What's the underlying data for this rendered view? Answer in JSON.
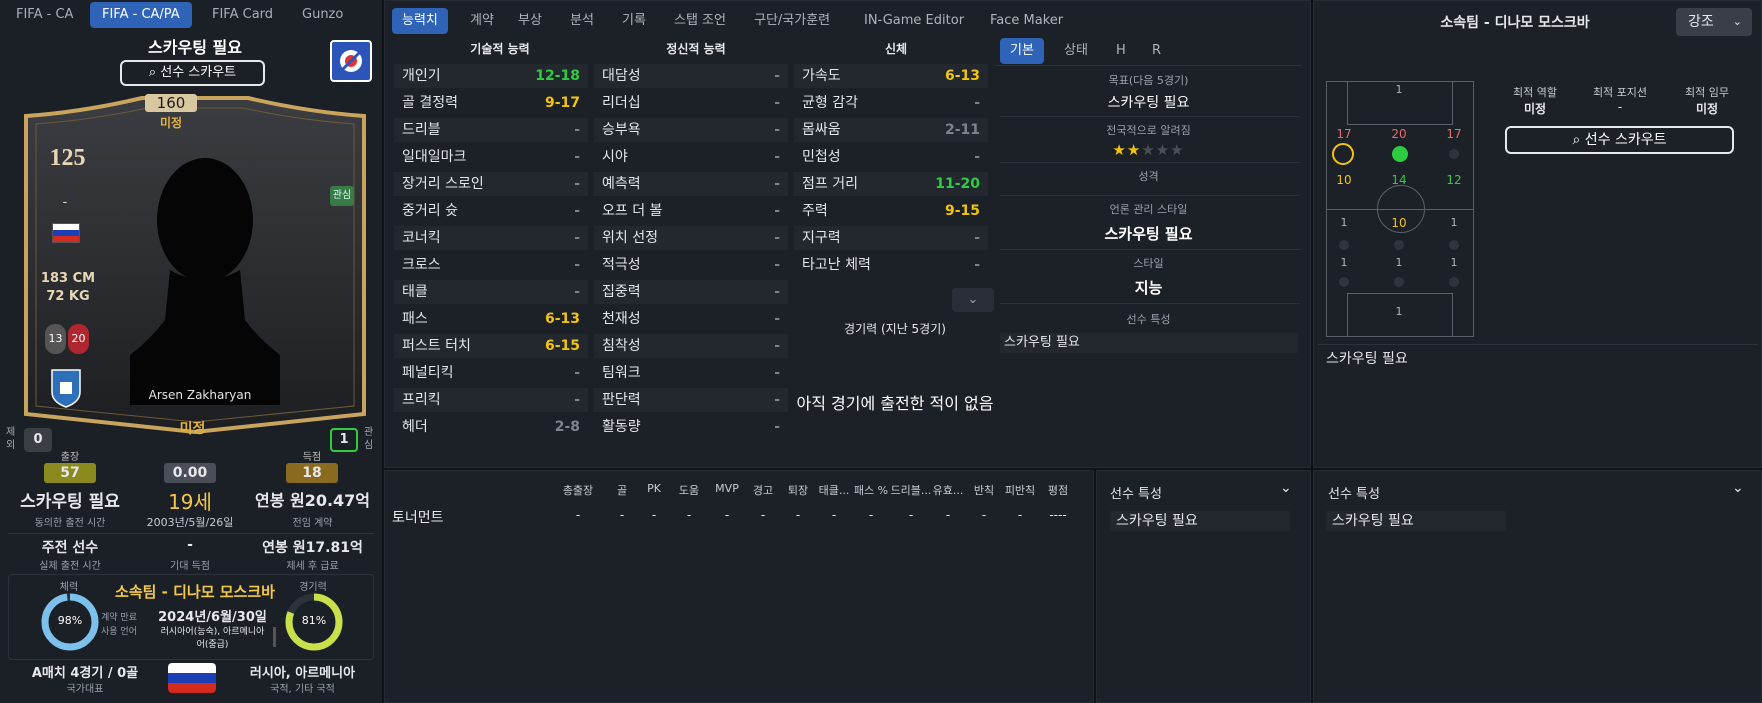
{
  "colors": {
    "accent": "#2e63b8",
    "green": "#2ecc40",
    "yellow": "#f1c40f",
    "red": "#e74c3c",
    "gold": "#c9a45c"
  },
  "top_tabs": [
    "FIFA - CA",
    "FIFA - CA/PA",
    "FIFA Card",
    "Gunzo"
  ],
  "card": {
    "title": "스카우팅 필요",
    "scout_button": "선수 스카우트",
    "pa": "160",
    "pa_label": "미정",
    "ca": "125",
    "dash": "-",
    "height": "183 CM",
    "weight": "72 KG",
    "foot_left": "13",
    "foot_right": "20",
    "tag": "관심",
    "name": "Arsen Zakharyan",
    "status": "미정",
    "flag_icon": "russia-flag-icon",
    "club_icon": "club-crest-icon"
  },
  "stats": {
    "excluded_label": "제외",
    "excluded_value": "0",
    "interest_label": "관심",
    "interest_value": "1",
    "apps_label": "출장",
    "apps_value": "57",
    "rating_value": "0.00",
    "goals_label": "득점",
    "goals_value": "18",
    "playtime": "스카우팅 필요",
    "playtime_label": "동의한 출전 시간",
    "age": "19세",
    "birth": "2003년/5월/26일",
    "salary": "연봉 원20.47억",
    "salary_label": "전임 계약",
    "role": "주전 선수",
    "role_label": "실제 출전 시간",
    "expected": "-",
    "expected_label": "기대 득점",
    "net_salary": "연봉 원17.81억",
    "net_salary_label": "제세 후 급료",
    "fitness_label": "체력",
    "fitness_value": "98%",
    "fitness_pct": 98,
    "club": "소속팀 - 디나모 모스크바",
    "contract_label": "계약 만료",
    "contract": "2024년/6월/30일",
    "language_label": "사용 언어",
    "language": "러시아어(능숙), 아르메니아어(중급)",
    "form_label": "경기력",
    "form_value": "81%",
    "form_pct": 81,
    "intl": "A매치 4경기 / 0골",
    "intl_label": "국가대표",
    "nation": "러시아, 아르메니아",
    "nation_label": "국적, 기타 국적"
  },
  "attr_tabs": [
    "능력치",
    "계약",
    "부상",
    "분석",
    "기록",
    "스탭 조언",
    "구단/국가훈련",
    "IN-Game Editor",
    "Face Maker"
  ],
  "technical": {
    "header": "기술적 능력",
    "rows": [
      [
        "개인기",
        "12-18",
        "g"
      ],
      [
        "골 결정력",
        "9-17",
        "y"
      ],
      [
        "드리블",
        "-",
        "n"
      ],
      [
        "일대일마크",
        "-",
        "n"
      ],
      [
        "장거리 스로인",
        "-",
        "n"
      ],
      [
        "중거리 슛",
        "-",
        "n"
      ],
      [
        "코너킥",
        "-",
        "n"
      ],
      [
        "크로스",
        "-",
        "n"
      ],
      [
        "태클",
        "-",
        "n"
      ],
      [
        "패스",
        "6-13",
        "y"
      ],
      [
        "퍼스트 터치",
        "6-15",
        "y"
      ],
      [
        "페널티킥",
        "-",
        "n"
      ],
      [
        "프리킥",
        "-",
        "n"
      ],
      [
        "헤더",
        "2-8",
        "n"
      ]
    ]
  },
  "mental": {
    "header": "정신적 능력",
    "rows": [
      [
        "대담성",
        "-",
        "n"
      ],
      [
        "리더십",
        "-",
        "n"
      ],
      [
        "승부욕",
        "-",
        "n"
      ],
      [
        "시야",
        "-",
        "n"
      ],
      [
        "예측력",
        "-",
        "n"
      ],
      [
        "오프 더 볼",
        "-",
        "n"
      ],
      [
        "위치 선정",
        "-",
        "n"
      ],
      [
        "적극성",
        "-",
        "n"
      ],
      [
        "집중력",
        "-",
        "n"
      ],
      [
        "천재성",
        "-",
        "n"
      ],
      [
        "침착성",
        "-",
        "n"
      ],
      [
        "팀워크",
        "-",
        "n"
      ],
      [
        "판단력",
        "-",
        "n"
      ],
      [
        "활동량",
        "-",
        "n"
      ]
    ]
  },
  "physical": {
    "header": "신체",
    "rows": [
      [
        "가속도",
        "6-13",
        "y"
      ],
      [
        "균형 감각",
        "-",
        "n"
      ],
      [
        "몸싸움",
        "2-11",
        "n"
      ],
      [
        "민첩성",
        "-",
        "n"
      ],
      [
        "점프 거리",
        "11-20",
        "g"
      ],
      [
        "주력",
        "9-15",
        "y"
      ],
      [
        "지구력",
        "-",
        "n"
      ],
      [
        "타고난 체력",
        "-",
        "n"
      ]
    ]
  },
  "form_section": {
    "title": "경기력 (지난 5경기)",
    "empty": "아직 경기에 출전한 적이 없음"
  },
  "info_tabs": [
    "기본",
    "상태",
    "H",
    "R"
  ],
  "info": {
    "target_label": "목표(다음 5경기)",
    "target_value": "스카우팅 필요",
    "rep_label": "전국적으로 알려짐",
    "rep_stars": 2,
    "personality_label": "성격",
    "media_label": "언론 관리 스타일",
    "media_value": "스카우팅 필요",
    "style_label": "스타일",
    "style_value": "지능",
    "traits_label": "선수 특성",
    "traits_value": "스카우팅 필요"
  },
  "right": {
    "title": "소속팀 - 디나모 모스크바",
    "dropdown": "강조",
    "best_role_label": "최적 역할",
    "best_role": "미정",
    "best_pos_label": "최적 포지션",
    "best_pos": "-",
    "best_duty_label": "최적 임무",
    "best_duty": "미정",
    "scout_button": "선수 스카우트",
    "footer_text": "스카우팅 필요",
    "pitch": {
      "row_top": [
        "1"
      ],
      "row_att": [
        "17",
        "20",
        "17"
      ],
      "row_am": [
        "10",
        "14",
        "12"
      ],
      "row_mid": [
        "1",
        "10",
        "1"
      ],
      "row_dm": [
        "1",
        "1",
        "1"
      ],
      "row_gk": [
        "1"
      ]
    }
  },
  "history": {
    "headers": [
      "총출장",
      "골",
      "PK",
      "도움",
      "MVP",
      "경고",
      "퇴장",
      "태클...",
      "패스 %",
      "드리블...",
      "유효...",
      "반칙",
      "피반칙",
      "평점"
    ],
    "row_label": "토너먼트",
    "row_values": [
      "-",
      "-",
      "-",
      "-",
      "-",
      "-",
      "-",
      "-",
      "-",
      "-",
      "-",
      "-",
      "-",
      "----"
    ]
  },
  "traits_panel1": {
    "title": "선수 특성",
    "value": "스카우팅 필요"
  },
  "traits_panel2": {
    "title": "선수 특성",
    "value": "스카우팅 필요"
  }
}
